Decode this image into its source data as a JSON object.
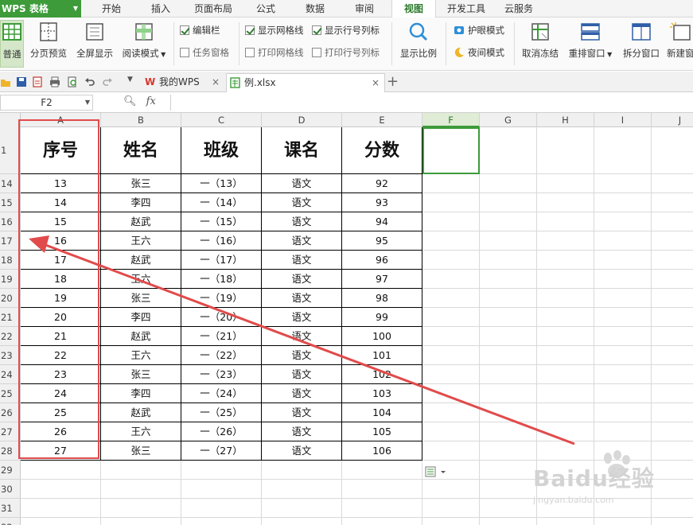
{
  "app": {
    "name": "WPS 表格"
  },
  "ribbon_tabs": [
    {
      "label": "开始"
    },
    {
      "label": "插入"
    },
    {
      "label": "页面布局"
    },
    {
      "label": "公式"
    },
    {
      "label": "数据"
    },
    {
      "label": "审阅"
    },
    {
      "label": "视图"
    },
    {
      "label": "开发工具"
    },
    {
      "label": "云服务"
    }
  ],
  "ribbon_active_tab": "视图",
  "ribbon": {
    "normal": "普通",
    "page_break_preview": "分页预览",
    "full_screen": "全屏显示",
    "reading_mode": "阅读模式",
    "formula_bar": "编辑栏",
    "task_pane": "任务窗格",
    "show_gridlines": "显示网格线",
    "show_headings": "显示行号列标",
    "print_gridlines": "打印网格线",
    "print_headings": "打印行号列标",
    "zoom": "显示比例",
    "eye_care": "护眼模式",
    "night_mode": "夜间模式",
    "unfreeze": "取消冻结",
    "arrange_windows": "重排窗口",
    "split_window": "拆分窗口",
    "new_window": "新建窗"
  },
  "checkboxes": {
    "formula_bar": true,
    "task_pane": false,
    "show_gridlines": true,
    "show_headings": true,
    "print_gridlines": false,
    "print_headings": false
  },
  "doc_tabs": [
    {
      "label": "我的WPS"
    },
    {
      "label": "例.xlsx"
    }
  ],
  "formula_bar": {
    "cell_ref": "F2",
    "fx": "fx",
    "value": ""
  },
  "columns": [
    "A",
    "B",
    "C",
    "D",
    "E",
    "F",
    "G",
    "H",
    "I",
    "J"
  ],
  "row_numbers": [
    "1",
    "14",
    "15",
    "16",
    "17",
    "18",
    "19",
    "20",
    "21",
    "22",
    "23",
    "24",
    "25",
    "26",
    "27",
    "28",
    "29",
    "30",
    "31",
    "32"
  ],
  "table": {
    "headers": [
      "序号",
      "姓名",
      "班级",
      "课名",
      "分数"
    ],
    "rows": [
      [
        "13",
        "张三",
        "一（13）",
        "语文",
        "92"
      ],
      [
        "14",
        "李四",
        "一（14）",
        "语文",
        "93"
      ],
      [
        "15",
        "赵武",
        "一（15）",
        "语文",
        "94"
      ],
      [
        "16",
        "王六",
        "一（16）",
        "语文",
        "95"
      ],
      [
        "17",
        "赵武",
        "一（17）",
        "语文",
        "96"
      ],
      [
        "18",
        "王六",
        "一（18）",
        "语文",
        "97"
      ],
      [
        "19",
        "张三",
        "一（19）",
        "语文",
        "98"
      ],
      [
        "20",
        "李四",
        "一（20）",
        "语文",
        "99"
      ],
      [
        "21",
        "赵武",
        "一（21）",
        "语文",
        "100"
      ],
      [
        "22",
        "王六",
        "一（22）",
        "语文",
        "101"
      ],
      [
        "23",
        "张三",
        "一（23）",
        "语文",
        "102"
      ],
      [
        "24",
        "李四",
        "一（24）",
        "语文",
        "103"
      ],
      [
        "25",
        "赵武",
        "一（25）",
        "语文",
        "104"
      ],
      [
        "26",
        "王六",
        "一（26）",
        "语文",
        "105"
      ],
      [
        "27",
        "张三",
        "一（27）",
        "语文",
        "106"
      ]
    ]
  },
  "colors": {
    "accent": "#3d9b3a",
    "annotation": "#e14b4b"
  },
  "watermark": {
    "brand": "Baidu经验",
    "site": "jingyan.baidu.com"
  }
}
